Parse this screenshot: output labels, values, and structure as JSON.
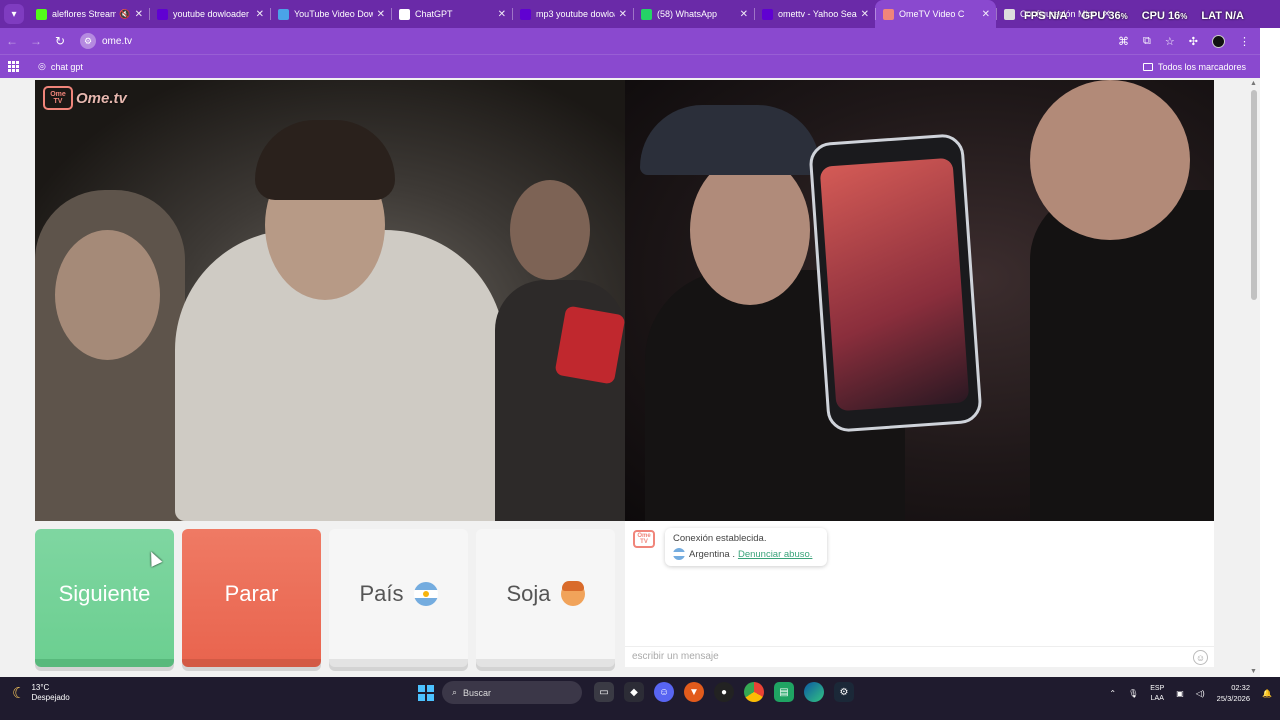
{
  "browser": {
    "tabs": [
      {
        "title": "aleflores Stream",
        "favicon": "kick-icon",
        "color": "#53fc18",
        "muted": true,
        "active": false
      },
      {
        "title": "youtube dowloader n",
        "favicon": "yahoo-icon",
        "color": "#6001d2",
        "active": false
      },
      {
        "title": "YouTube Video Dow",
        "favicon": "download-icon",
        "color": "#4aa3e8",
        "active": false
      },
      {
        "title": "ChatGPT",
        "favicon": "chatgpt-icon",
        "color": "#ffffff",
        "active": false
      },
      {
        "title": "mp3 youtube dowloa",
        "favicon": "yahoo-icon",
        "color": "#6001d2",
        "active": false
      },
      {
        "title": "(58) WhatsApp",
        "favicon": "whatsapp-icon",
        "color": "#25d366",
        "active": false
      },
      {
        "title": "omettv - Yahoo Sear",
        "favicon": "yahoo-icon",
        "color": "#6001d2",
        "active": false
      },
      {
        "title": "OmeTV Video C",
        "favicon": "ometv-icon",
        "color": "#f0857a",
        "active": true
      },
      {
        "title": "Configuración Micr",
        "favicon": "settings-icon",
        "color": "#dddddd",
        "active": false
      }
    ],
    "url": "ome.tv",
    "bookmarks": [
      {
        "label": "chat gpt",
        "icon": "chatgpt-icon"
      }
    ],
    "all_bookmarks": "Todos los marcadores"
  },
  "overlay": {
    "fps_label": "FPS",
    "fps_value": "N/A",
    "gpu_label": "GPU",
    "gpu_value": "36",
    "gpu_unit": "%",
    "cpu_label": "CPU",
    "cpu_value": "16",
    "cpu_unit": "%",
    "lat_label": "LAT",
    "lat_value": "N/A"
  },
  "app": {
    "logo_text": "Ome.tv",
    "logo_badge": "Ome TV",
    "buttons": {
      "next": "Siguiente",
      "stop": "Parar",
      "country": "País",
      "gender": "Soja"
    },
    "colors": {
      "next": "#6ccf91",
      "stop": "#e9654f",
      "report_link": "#3aa37a"
    }
  },
  "chat": {
    "status": "Conexión establecida.",
    "country": "Argentina",
    "separator": ".",
    "report_link": "Denunciar abuso.",
    "input_placeholder": "escribir un mensaje"
  },
  "taskbar": {
    "weather_temp": "13°C",
    "weather_desc": "Despejado",
    "search_placeholder": "Buscar",
    "lang_top": "ESP",
    "lang_bottom": "LAA",
    "time": "02:32",
    "date": "25/3/2026"
  }
}
